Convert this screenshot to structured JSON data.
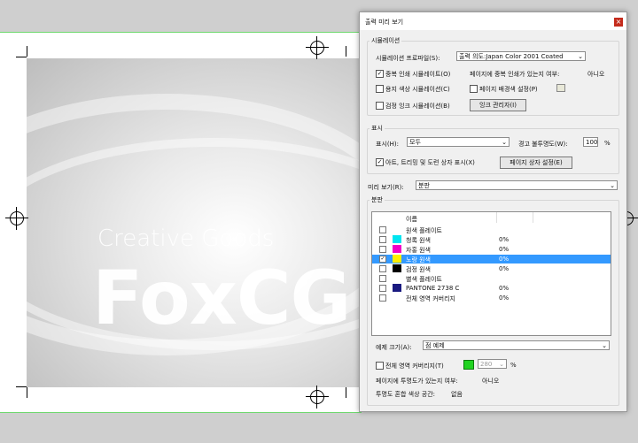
{
  "artwork": {
    "line1": "Creative Goods",
    "line2": "FoxCG"
  },
  "dialog": {
    "title": "출력 미리 보기",
    "close_glyph": "×",
    "simulation": {
      "legend": "시뮬레이션",
      "profile_label": "시뮬레이션 프로파일(S):",
      "profile_value": "출력 의도:Japan Color 2001 Coated",
      "overprint_label": "중복 인쇄 시뮬레이트(O)",
      "overprint_checked": true,
      "page_overprint_label": "페이지에 중복 인쇄가 있는지 여부:",
      "page_overprint_value": "아니오",
      "paper_color_label": "용지 색상 시뮬레이션(C)",
      "paper_color_checked": false,
      "page_bg_label": "페이지 배경색 설정(P)",
      "page_bg_checked": false,
      "black_ink_label": "검정 잉크 시뮬레이션(B)",
      "black_ink_checked": false,
      "ink_manager_label": "잉크 관리자(I)"
    },
    "display": {
      "legend": "표시",
      "show_label": "표시(H):",
      "show_value": "모두",
      "warning_label": "경고 불투명도(W):",
      "warning_value": "100",
      "warning_unit": "%",
      "boxes_label": "아트, 트리밍 및 도련 상자 표시(X)",
      "boxes_checked": true,
      "page_box_label": "페이지 상자 설정(E)"
    },
    "preview": {
      "label": "미리 보기(R):",
      "value": "분판"
    },
    "separations": {
      "legend": "분판",
      "col_name": "이름",
      "rows": [
        {
          "checked": false,
          "swatch": "",
          "name": "원색 플레이트",
          "pct": ""
        },
        {
          "checked": false,
          "swatch": "#00e5f0",
          "name": "청록 원색",
          "pct": "0%"
        },
        {
          "checked": false,
          "swatch": "#f000c8",
          "name": "자홍 원색",
          "pct": "0%"
        },
        {
          "checked": true,
          "swatch": "#ffee00",
          "name": "노랑 원색",
          "pct": "0%"
        },
        {
          "checked": false,
          "swatch": "#000000",
          "name": "검정 원색",
          "pct": "0%"
        },
        {
          "checked": false,
          "swatch": "",
          "name": "별색 플레이트",
          "pct": ""
        },
        {
          "checked": false,
          "swatch": "#1a1a80",
          "name": "PANTONE 2738 C",
          "pct": "0%"
        },
        {
          "checked": false,
          "swatch": "",
          "name": "전체 영역 커버리지",
          "pct": "0%"
        }
      ],
      "sample_label": "예제 크기(A):",
      "sample_value": "점 예제",
      "coverage_label": "전체 영역 커버리지(T)",
      "coverage_checked": false,
      "coverage_color": "#21d321",
      "coverage_value": "280",
      "coverage_unit": "%",
      "transparency_label": "페이지에 투명도가 있는지 여부:",
      "transparency_value": "아니오",
      "blend_label": "투명도 혼합 색상 공간:",
      "blend_value": "없음"
    }
  }
}
